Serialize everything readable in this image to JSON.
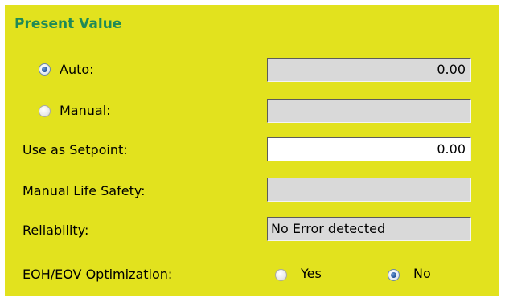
{
  "panel": {
    "title": "Present Value"
  },
  "rows": {
    "auto": {
      "label": "Auto:",
      "selected": true,
      "value": "0.00"
    },
    "manual": {
      "label": "Manual:",
      "selected": false,
      "value": ""
    },
    "setpoint": {
      "label": "Use as Setpoint:",
      "value": "0.00"
    },
    "life_safety": {
      "label": "Manual Life Safety:",
      "value": ""
    },
    "reliability": {
      "label": "Reliability:",
      "value": "No Error detected"
    }
  },
  "optimization": {
    "label": "EOH/EOV Optimization:",
    "yes_label": "Yes",
    "no_label": "No",
    "selected": "No"
  },
  "colors": {
    "panel_background": "#e2e21e",
    "title": "#1f8a57",
    "disabled_field": "#d9d9d9",
    "editable_field": "#ffffff"
  }
}
